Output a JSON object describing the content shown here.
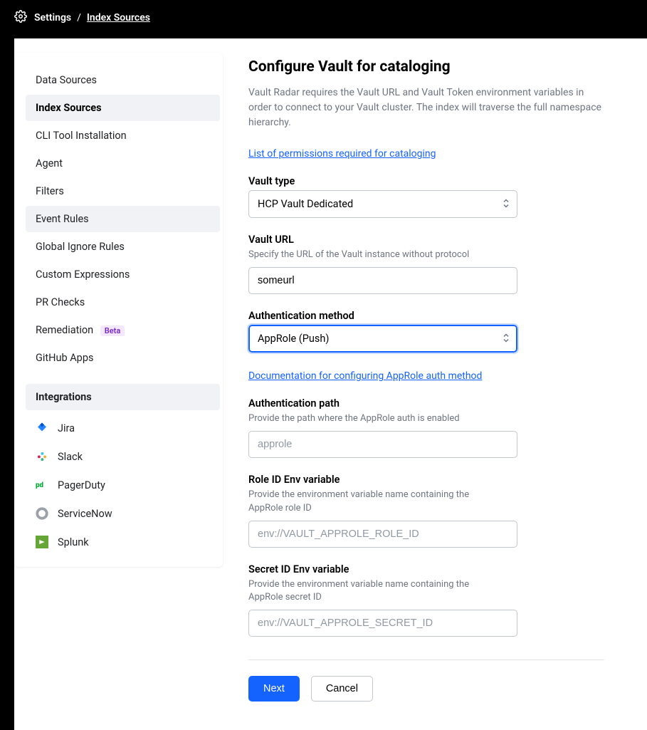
{
  "breadcrumb": {
    "root": "Settings",
    "current": "Index Sources"
  },
  "sidebar": {
    "items": [
      {
        "label": "Data Sources"
      },
      {
        "label": "Index Sources"
      },
      {
        "label": "CLI Tool Installation"
      },
      {
        "label": "Agent"
      },
      {
        "label": "Filters"
      },
      {
        "label": "Event Rules"
      },
      {
        "label": "Global Ignore Rules"
      },
      {
        "label": "Custom Expressions"
      },
      {
        "label": "PR Checks"
      },
      {
        "label": "Remediation",
        "badge": "Beta"
      },
      {
        "label": "GitHub Apps"
      }
    ],
    "integrations_header": "Integrations",
    "integrations": [
      {
        "label": "Jira"
      },
      {
        "label": "Slack"
      },
      {
        "label": "PagerDuty"
      },
      {
        "label": "ServiceNow"
      },
      {
        "label": "Splunk"
      }
    ]
  },
  "main": {
    "title": "Configure Vault for cataloging",
    "description": "Vault Radar requires the Vault URL and Vault Token environment variables in order to connect to your Vault cluster. The index will traverse the full namespace hierarchy.",
    "perm_link": "List of permissions required for cataloging",
    "vault_type": {
      "label": "Vault type",
      "value": "HCP Vault Dedicated"
    },
    "vault_url": {
      "label": "Vault URL",
      "hint": "Specify the URL of the Vault instance without protocol",
      "value": "someurl"
    },
    "auth_method": {
      "label": "Authentication method",
      "value": "AppRole (Push)"
    },
    "auth_doc_link": "Documentation for configuring AppRole auth method",
    "auth_path": {
      "label": "Authentication path",
      "hint": "Provide the path where the AppRole auth is enabled",
      "placeholder": "approle"
    },
    "role_id": {
      "label": "Role ID Env variable",
      "hint": "Provide the environment variable name containing the AppRole role ID",
      "placeholder": "env://VAULT_APPROLE_ROLE_ID"
    },
    "secret_id": {
      "label": "Secret ID Env variable",
      "hint": "Provide the environment variable name containing the AppRole secret ID",
      "placeholder": "env://VAULT_APPROLE_SECRET_ID"
    },
    "buttons": {
      "next": "Next",
      "cancel": "Cancel"
    }
  }
}
